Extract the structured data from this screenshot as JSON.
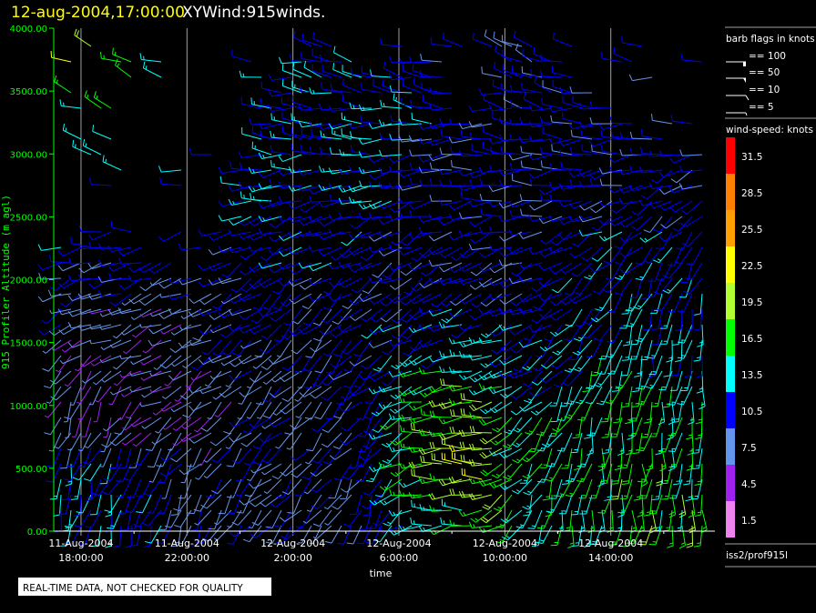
{
  "header": {
    "datetime": "12-aug-2004,17:00:00",
    "title": "XYWind:915winds."
  },
  "notice": "REAL-TIME DATA, NOT CHECKED FOR QUALITY",
  "legend": {
    "flags_title": "barb flags in knots",
    "flags": [
      {
        "label": "== 100",
        "knots": 100
      },
      {
        "label": "== 50",
        "knots": 50
      },
      {
        "label": "== 10",
        "knots": 10
      },
      {
        "label": "== 5",
        "knots": 5
      }
    ],
    "speed_title": "wind-speed: knots",
    "source": "iss2/prof915l"
  },
  "colors": {
    "title": "#ffff00",
    "axis_y": "#00ff00",
    "grid": "#a0a0a0"
  },
  "chart_data": {
    "type": "wind-barb",
    "xlabel": "time",
    "ylabel": "915 Profiler Altitude (m agl)",
    "ylim": [
      0,
      4000
    ],
    "xlim_hours": [
      -1.03,
      23.93
    ],
    "x_origin": "11-Aug-2004 18:00:00",
    "yticks": [
      "0.00",
      "500.00",
      "1000.00",
      "1500.00",
      "2000.00",
      "2500.00",
      "3000.00",
      "3500.00",
      "4000.00"
    ],
    "xticks": [
      {
        "hour": 0,
        "date": "11-Aug-2004",
        "time": "18:00:00"
      },
      {
        "hour": 4,
        "date": "11-Aug-2004",
        "time": "22:00:00"
      },
      {
        "hour": 8,
        "date": "12-Aug-2004",
        "time": "2:00:00"
      },
      {
        "hour": 12,
        "date": "12-Aug-2004",
        "time": "6:00:00"
      },
      {
        "hour": 16,
        "date": "12-Aug-2004",
        "time": "10:00:00"
      },
      {
        "hour": 20,
        "date": "12-Aug-2004",
        "time": "14:00:00"
      }
    ],
    "colorbar": [
      {
        "label": "31.5",
        "color": "#ff0000"
      },
      {
        "label": "28.5",
        "color": "#ff8000"
      },
      {
        "label": "25.5",
        "color": "#ffa000"
      },
      {
        "label": "22.5",
        "color": "#ffff00"
      },
      {
        "label": "19.5",
        "color": "#b0ff30"
      },
      {
        "label": "16.5",
        "color": "#00ff00"
      },
      {
        "label": "13.5",
        "color": "#00ffff"
      },
      {
        "label": "10.5",
        "color": "#0000ff"
      },
      {
        "label": "7.5",
        "color": "#6495ed"
      },
      {
        "label": "4.5",
        "color": "#a020f0"
      },
      {
        "label": "1.5",
        "color": "#ee82ee"
      }
    ],
    "colorbar_bin_knots": 3,
    "wind_field": {
      "hours": [
        -1,
        1,
        3,
        5,
        7,
        9,
        11,
        13,
        15,
        17,
        19,
        21,
        23
      ],
      "altitudes": [
        0,
        500,
        1000,
        1500,
        2000,
        2500,
        3000,
        3500,
        4000
      ],
      "top_altitude": [
        2300,
        2400,
        2200,
        2000,
        3300,
        4000,
        3600,
        3800,
        3300,
        4000,
        3600,
        3200,
        3000
      ],
      "speed_knots": [
        [
          12,
          12,
          11,
          9,
          8,
          8,
          9,
          14,
          16,
          14,
          15,
          16,
          17
        ],
        [
          12,
          11,
          9,
          8,
          8,
          9,
          10,
          18,
          21,
          15,
          15,
          17,
          16
        ],
        [
          6,
          5,
          5,
          6,
          8,
          9,
          10,
          17,
          18,
          13,
          14,
          16,
          14
        ],
        [
          7,
          6,
          6,
          8,
          9,
          9,
          10,
          12,
          13,
          11,
          12,
          14,
          12
        ],
        [
          9,
          9,
          9,
          9,
          10,
          10,
          10,
          9,
          9,
          10,
          11,
          12,
          11
        ],
        [
          12,
          12,
          11,
          11,
          11,
          11,
          11,
          10,
          10,
          10,
          10,
          11,
          10
        ],
        [
          13,
          13,
          12,
          12,
          12,
          11,
          12,
          10,
          10,
          10,
          10,
          10,
          10
        ],
        [
          16,
          16,
          14,
          13,
          12,
          11,
          12,
          11,
          10,
          10,
          10,
          10,
          10
        ],
        [
          30,
          16,
          15,
          14,
          12,
          11,
          12,
          11,
          10,
          10,
          10,
          10,
          10
        ]
      ],
      "direction_deg": [
        [
          190,
          190,
          200,
          210,
          220,
          220,
          200,
          260,
          265,
          200,
          190,
          185,
          180
        ],
        [
          190,
          200,
          210,
          220,
          225,
          220,
          210,
          265,
          270,
          210,
          190,
          185,
          180
        ],
        [
          200,
          210,
          240,
          230,
          225,
          220,
          220,
          260,
          265,
          230,
          200,
          190,
          185
        ],
        [
          230,
          240,
          250,
          235,
          230,
          225,
          230,
          240,
          250,
          240,
          210,
          195,
          190
        ],
        [
          250,
          255,
          250,
          240,
          235,
          230,
          240,
          235,
          240,
          245,
          230,
          210,
          200
        ],
        [
          270,
          270,
          265,
          260,
          255,
          250,
          250,
          250,
          255,
          260,
          250,
          240,
          230
        ],
        [
          285,
          285,
          280,
          275,
          270,
          265,
          265,
          265,
          270,
          270,
          265,
          260,
          250
        ],
        [
          295,
          295,
          290,
          285,
          280,
          280,
          280,
          280,
          280,
          285,
          280,
          275,
          270
        ],
        [
          300,
          300,
          295,
          290,
          285,
          285,
          285,
          285,
          285,
          290,
          285,
          280,
          275
        ]
      ]
    }
  }
}
